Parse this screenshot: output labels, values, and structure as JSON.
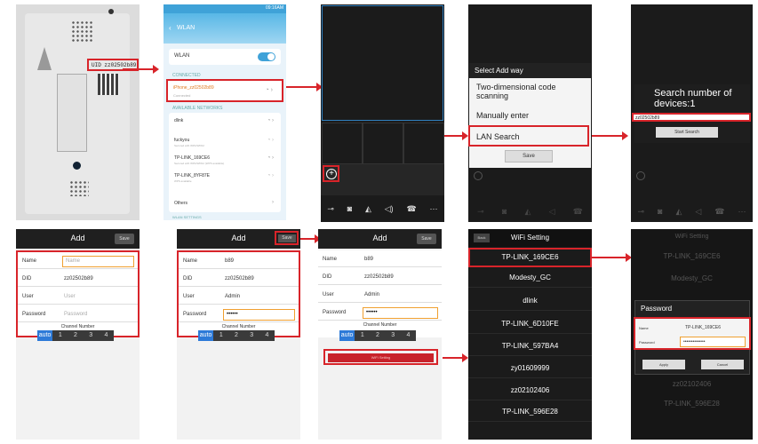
{
  "device": {
    "label": "UID zz02502b89"
  },
  "wlan": {
    "title": "WLAN",
    "toggle_label": "WLAN",
    "connected_header": "CONNECTED",
    "connected_ssid": "iPhone_zz02502b89",
    "connected_status": "Connected",
    "available_header": "AVAILABLE NETWORKS",
    "networks": [
      {
        "ssid": "dlink",
        "sub": ""
      },
      {
        "ssid": "fuckyou",
        "sub": "Secured with WPA/WPA2"
      },
      {
        "ssid": "TP-LINK_169CE6",
        "sub": "Secured with WPA/WPA2 (WPS available)"
      },
      {
        "ssid": "TP-LINK_8YF87E",
        "sub": "WPS available"
      }
    ],
    "others": "Others",
    "settings_header": "WLAN SETTINGS"
  },
  "select_add": {
    "title": "Select Add way",
    "opt1": "Two-dimensional code scanning",
    "opt2": "Manually enter",
    "opt3": "LAN Search",
    "ok": "Save"
  },
  "search": {
    "title": "Search number of devices:1",
    "item": "zz02502b89",
    "button": "Start Search"
  },
  "add1": {
    "title": "Add",
    "save": "Save",
    "name_label": "Name",
    "name_ph": "Name",
    "did_label": "DID",
    "did_val": "zz02502b89",
    "user_label": "User",
    "user_ph": "User",
    "pwd_label": "Password",
    "pwd_ph": "Password",
    "channel_label": "Channel Number"
  },
  "add2": {
    "title": "Add",
    "save": "Save",
    "name_label": "Name",
    "name_val": "b89",
    "did_label": "DID",
    "did_val": "zz02502b89",
    "user_label": "User",
    "user_val": "Admin",
    "pwd_label": "Password",
    "pwd_val": "••••••",
    "channel_label": "Channel Number"
  },
  "add3": {
    "title": "Add",
    "save": "Save",
    "name_label": "Name",
    "name_val": "b89",
    "did_label": "DID",
    "did_val": "zz02502b89",
    "user_label": "User",
    "user_val": "Admin",
    "pwd_label": "Password",
    "pwd_val": "••••••",
    "channel_label": "Channel Number",
    "wifi_btn": "WiFi Setting"
  },
  "channels": [
    "auto",
    "1",
    "2",
    "3",
    "4"
  ],
  "wifi": {
    "back": "Back",
    "title": "WiFi Setting",
    "list": [
      "TP-LINK_169CE6",
      "Modesty_GC",
      "dlink",
      "TP-LINK_6D10FE",
      "TP-LINK_597BA4",
      "zy01609999",
      "zz02102406",
      "TP-LINK_596E28"
    ]
  },
  "pwd_dialog": {
    "bg_title": "WiFi Setting",
    "bg_items": [
      "TP-LINK_169CE6",
      "Modesty_GC",
      "zz02102406",
      "TP-LINK_596E28"
    ],
    "title": "Password",
    "name_label": "Name",
    "name_val": "TP-LINK_169CE6",
    "pwd_label": "Password",
    "pwd_val": "••••••••••••••",
    "apply": "Apply",
    "cancel": "Cancel"
  },
  "statusbar": {
    "time": "09:16AM"
  }
}
